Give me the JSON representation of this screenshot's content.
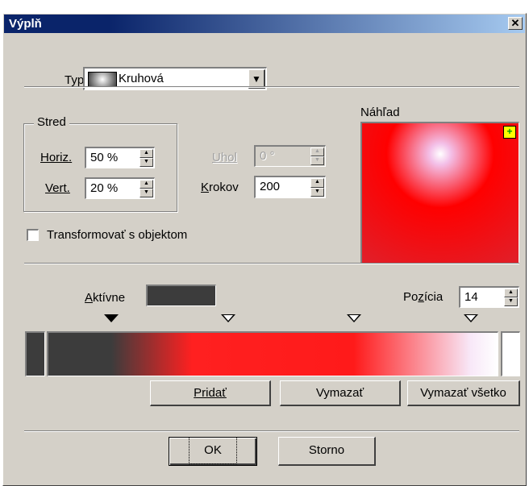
{
  "dialog": {
    "title": "Výplň",
    "close_glyph": "✕"
  },
  "type_row": {
    "label": "Typ",
    "value": "Kruhová",
    "arrow": "▼"
  },
  "center": {
    "group_label": "Stred",
    "horiz_label": "Horiz.",
    "horiz_value": "50 %",
    "vert_label": "Vert.",
    "vert_value": "20 %"
  },
  "angle": {
    "label": "Uhol",
    "value": "0 °"
  },
  "steps": {
    "label": "Krokov",
    "value": "200"
  },
  "preview": {
    "label": "Náhľad",
    "plus": "+",
    "colors": {
      "center": "#ffffff",
      "mid": "#ff0000",
      "outer": "#e0202a"
    }
  },
  "transform": {
    "label": "Transformovať s objektom",
    "checked": false
  },
  "gradient": {
    "active_label": "Aktívne",
    "active_color": "#3c3c3c",
    "position_label": "Pozícia",
    "position_value": "14",
    "start_color": "#3c3c3c",
    "end_color": "#ffffff",
    "stops_percent": [
      14,
      40,
      68,
      94
    ],
    "selected_stop": 0
  },
  "buttons": {
    "add": "Pridať",
    "delete": "Vymazať",
    "delete_all": "Vymazať všetko",
    "ok": "OK",
    "cancel": "Storno"
  }
}
